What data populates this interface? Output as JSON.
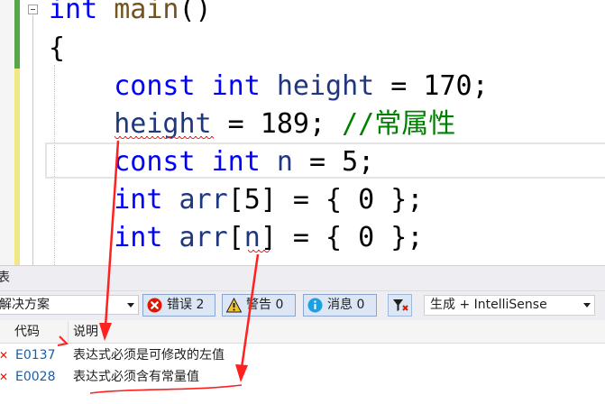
{
  "editor": {
    "lines": [
      {
        "parts": [
          {
            "t": "int",
            "c": "kw"
          },
          {
            "t": " "
          },
          {
            "t": "main",
            "c": "fn"
          },
          {
            "t": "()"
          }
        ]
      },
      {
        "parts": [
          {
            "t": "{"
          }
        ]
      },
      {
        "parts": [
          {
            "t": "    "
          },
          {
            "t": "const",
            "c": "kw"
          },
          {
            "t": " "
          },
          {
            "t": "int",
            "c": "kw"
          },
          {
            "t": " "
          },
          {
            "t": "height",
            "c": "id"
          },
          {
            "t": " = 170;"
          }
        ]
      },
      {
        "parts": [
          {
            "t": "    "
          },
          {
            "t": "height",
            "c": "id"
          },
          {
            "t": " = 189; "
          },
          {
            "t": "//常属性",
            "c": "cm"
          }
        ]
      },
      {
        "parts": [
          {
            "t": "    "
          },
          {
            "t": "const",
            "c": "kw"
          },
          {
            "t": " "
          },
          {
            "t": "int",
            "c": "kw"
          },
          {
            "t": " "
          },
          {
            "t": "n",
            "c": "id"
          },
          {
            "t": " = 5;"
          }
        ]
      },
      {
        "parts": [
          {
            "t": "    "
          },
          {
            "t": "int",
            "c": "kw"
          },
          {
            "t": " "
          },
          {
            "t": "arr",
            "c": "id"
          },
          {
            "t": "[5] = { 0 };"
          }
        ]
      },
      {
        "parts": [
          {
            "t": "    "
          },
          {
            "t": "int",
            "c": "kw"
          },
          {
            "t": " "
          },
          {
            "t": "arr",
            "c": "id"
          },
          {
            "t": "["
          },
          {
            "t": "n",
            "c": "id"
          },
          {
            "t": "] = { 0 };"
          }
        ]
      }
    ]
  },
  "error_list": {
    "title": "表",
    "scope_label": "解决方案",
    "errors_label": "错误 2",
    "warnings_label": "警告 0",
    "messages_label": "消息 0",
    "build_filter": "生成 + IntelliSense",
    "columns": {
      "code": "代码",
      "description": "说明"
    },
    "rows": [
      {
        "code": "E0137",
        "description": "表达式必须是可修改的左值"
      },
      {
        "code": "E0028",
        "description": "表达式必须含有常量值"
      }
    ]
  },
  "colors": {
    "keyword": "#0000ff",
    "comment": "#008000",
    "error": "#e51400",
    "arrow": "#ff2020"
  }
}
